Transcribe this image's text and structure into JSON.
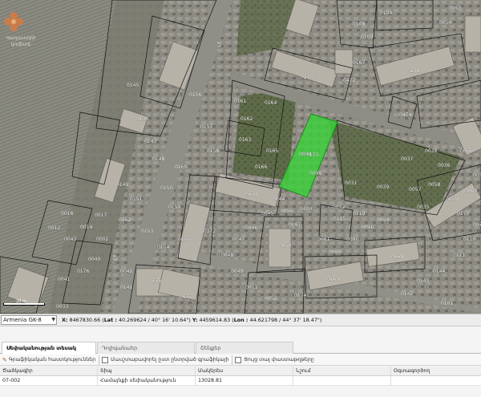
{
  "map": {
    "logo_line1": "Կադաստրի",
    "logo_line2": "կոմիտե",
    "scale_label": "20 m",
    "road_labels": [
      "43",
      "43"
    ],
    "parcels": [
      "0271",
      "0474",
      "0270",
      "0472",
      "0108",
      "0109",
      "0104",
      "0145",
      "0146",
      "0147",
      "0148",
      "0149",
      "0150",
      "0151",
      "0152",
      "0153",
      "0154",
      "0155",
      "0156",
      "0157",
      "0158",
      "0159",
      "0160",
      "0161",
      "0162",
      "0163",
      "0164",
      "0165",
      "0166",
      "0167",
      "0168",
      "0169",
      "0170",
      "0171",
      "0172",
      "0173",
      "0174",
      "0175",
      "0176",
      "0177",
      "0035",
      "0036",
      "0033",
      "0041",
      "0040",
      "0043",
      "0002",
      "0018",
      "0014",
      "0017",
      "0012",
      "0042",
      "0141",
      "0142",
      "0143",
      "0144",
      "0121",
      "0110",
      "0076",
      "0101",
      "0098",
      "0115",
      "0119",
      "0050",
      "0081",
      "0089",
      "0090",
      "0091",
      "0094",
      "0095",
      "0097",
      "0100",
      "0044",
      "0045",
      "0046",
      "0047",
      "0048",
      "0049",
      "0051",
      "0052",
      "0053",
      "0054",
      "0055",
      "0056",
      "0057",
      "0058",
      "0059",
      "0060",
      "0034",
      "0037",
      "0038",
      "0039",
      "0031",
      "0032"
    ],
    "highlight_parcel": "0044"
  },
  "coords": {
    "crs": "Armenia GK-8",
    "x_label": "X:",
    "x_value": "8467830.66",
    "lat_label": "Lat :",
    "lat_value": "40.269624 / 40° 16' 10.64\"",
    "y_label": "Y:",
    "y_value": "4459614.83",
    "lon_label": "Lon :",
    "lon_value": "44.621798 / 44° 37' 18.47\""
  },
  "tabs": [
    {
      "label": "Սեփականության տեսակ",
      "active": true
    },
    {
      "label": "Դոլիգանաեր",
      "active": false
    },
    {
      "label": "Շենքեր",
      "active": false
    }
  ],
  "toolbar": {
    "graphic_button": "Գրաֆիկական հաստկություններ",
    "cb1_label": "Մասշտաբավորել ըստ ընտրված գրաֆիկայի",
    "cb2_label": "Ցույց տալ փաստաթղթերը"
  },
  "grid": {
    "columns": [
      "Ծածկագիր",
      "Տիպ",
      "Մակերես",
      "Նշում",
      "Օգտագործող"
    ],
    "rows": [
      [
        "07-002",
        "Համայնքի սեփականություն",
        "13028.81",
        "",
        ""
      ]
    ]
  },
  "colors": {
    "highlight_fill": "#3ad13a",
    "parcel_line": "#111111",
    "road_label": "#ffffff"
  }
}
